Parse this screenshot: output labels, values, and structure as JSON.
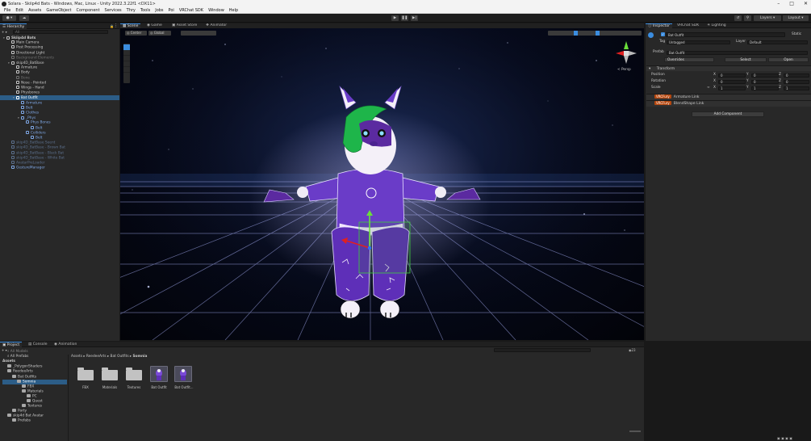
{
  "window": {
    "title": "Solara - Skiip4d Bats - Windows, Mac, Linux - Unity 2022.3.22f1 <DX11>"
  },
  "menu": [
    "File",
    "Edit",
    "Assets",
    "GameObject",
    "Component",
    "Services",
    "Thry",
    "Tools",
    "Jobs",
    "Poi",
    "VRChat SDK",
    "Window",
    "Help"
  ],
  "toolbar": {
    "layers": "Layers",
    "layout": "Layout"
  },
  "hierarchy": {
    "tab": "Hierarchy",
    "search_placeholder": "All",
    "rows": [
      {
        "label": "Skiip4d Bats",
        "indent": 0,
        "kind": "scene"
      },
      {
        "label": "Main Camera",
        "indent": 1,
        "kind": "normal"
      },
      {
        "label": "Post Processing",
        "indent": 1,
        "kind": "normal"
      },
      {
        "label": "Directional Light",
        "indent": 1,
        "kind": "normal"
      },
      {
        "label": "Background Elements",
        "indent": 1,
        "kind": "dim"
      },
      {
        "label": "skip4D_BatBase",
        "indent": 1,
        "kind": "normal"
      },
      {
        "label": "Armature",
        "indent": 2,
        "kind": "normal"
      },
      {
        "label": "Body",
        "indent": 2,
        "kind": "normal"
      },
      {
        "label": "Bone",
        "indent": 2,
        "kind": "dim"
      },
      {
        "label": "Nose - Pointed",
        "indent": 2,
        "kind": "normal"
      },
      {
        "label": "Wings - Hand",
        "indent": 2,
        "kind": "normal"
      },
      {
        "label": "Physbones",
        "indent": 2,
        "kind": "normal"
      },
      {
        "label": "Bat Outfit",
        "indent": 2,
        "kind": "sel"
      },
      {
        "label": "Armature",
        "indent": 3,
        "kind": "pre"
      },
      {
        "label": "Belt",
        "indent": 3,
        "kind": "pre"
      },
      {
        "label": "Clothes",
        "indent": 3,
        "kind": "pre"
      },
      {
        "label": "_Phys",
        "indent": 3,
        "kind": "pre"
      },
      {
        "label": "Phys Bones",
        "indent": 4,
        "kind": "pre"
      },
      {
        "label": "Belt",
        "indent": 5,
        "kind": "pre"
      },
      {
        "label": "Colliders",
        "indent": 4,
        "kind": "pre"
      },
      {
        "label": "Belt",
        "indent": 5,
        "kind": "pre"
      },
      {
        "label": "skip4D_BatBase Seent",
        "indent": 1,
        "kind": "predim"
      },
      {
        "label": "skip4D_BatBase - Brown Bat",
        "indent": 1,
        "kind": "predim"
      },
      {
        "label": "skip4D_BatBase - Black Bat",
        "indent": 1,
        "kind": "predim"
      },
      {
        "label": "skip4D_BatBase - White Bat",
        "indent": 1,
        "kind": "predim"
      },
      {
        "label": "AvatarPreLoader",
        "indent": 1,
        "kind": "predim"
      },
      {
        "label": "GestureManager",
        "indent": 1,
        "kind": "pre"
      }
    ]
  },
  "scene": {
    "tabs": [
      "Scene",
      "Game",
      "Asset Store",
      "Animator"
    ],
    "pivot": "Center",
    "space": "Global",
    "persp": "< Persp"
  },
  "inspector": {
    "tabs": [
      "Inspector",
      "VRChat SDK",
      "Lighting"
    ],
    "name": "Bat Outfit",
    "static_label": "Static",
    "tag_label": "Tag",
    "tag_value": "Untagged",
    "layer_label": "Layer",
    "layer_value": "Default",
    "prefab_label": "Prefab",
    "prefab_value": "Bat Outfit",
    "overrides": "Overrides",
    "select": "Select",
    "open": "Open",
    "transform": {
      "title": "Transform",
      "position": {
        "label": "Position",
        "x": "0",
        "y": "0",
        "z": "0"
      },
      "rotation": {
        "label": "Rotation",
        "x": "0",
        "y": "0",
        "z": "0"
      },
      "scale": {
        "label": "Scale",
        "x": "1",
        "y": "1",
        "z": "1"
      }
    },
    "components": [
      {
        "badge": "VRCFury",
        "name": "Armature Link"
      },
      {
        "badge": "VRCFury",
        "name": "BlendShape Link"
      }
    ],
    "add_component": "Add Component"
  },
  "project": {
    "tabs": [
      "Project",
      "Console",
      "Animation"
    ],
    "tree": [
      {
        "label": "All Models",
        "indent": 1,
        "kind": "dim"
      },
      {
        "label": "All Prefabs",
        "indent": 1,
        "kind": "normal"
      },
      {
        "label": "Assets",
        "indent": 0,
        "kind": "bold"
      },
      {
        "label": "_PolygonShaders",
        "indent": 1,
        "kind": "folder"
      },
      {
        "label": "ReedeeArts",
        "indent": 1,
        "kind": "folder"
      },
      {
        "label": "Bat Outfits",
        "indent": 2,
        "kind": "folder"
      },
      {
        "label": "Somnia",
        "indent": 3,
        "kind": "folder-sel"
      },
      {
        "label": "FBX",
        "indent": 4,
        "kind": "folder"
      },
      {
        "label": "Materials",
        "indent": 4,
        "kind": "folder"
      },
      {
        "label": "PC",
        "indent": 5,
        "kind": "folder"
      },
      {
        "label": "Quest",
        "indent": 5,
        "kind": "folder"
      },
      {
        "label": "Textures",
        "indent": 4,
        "kind": "folder"
      },
      {
        "label": "Party",
        "indent": 2,
        "kind": "folder"
      },
      {
        "label": "skip4d Bat Avatar",
        "indent": 1,
        "kind": "folder"
      },
      {
        "label": "Prefabs",
        "indent": 2,
        "kind": "folder"
      }
    ],
    "breadcrumb": [
      "Assets",
      "ReedeeArts",
      "Bat Outfits",
      "Somnia"
    ],
    "assets": [
      {
        "label": "FBX",
        "type": "folder"
      },
      {
        "label": "Materials",
        "type": "folder"
      },
      {
        "label": "Textures",
        "type": "folder"
      },
      {
        "label": "Bat Outfit",
        "type": "prefab"
      },
      {
        "label": "Bat Outfit...",
        "type": "prefab"
      }
    ],
    "count": "23"
  }
}
